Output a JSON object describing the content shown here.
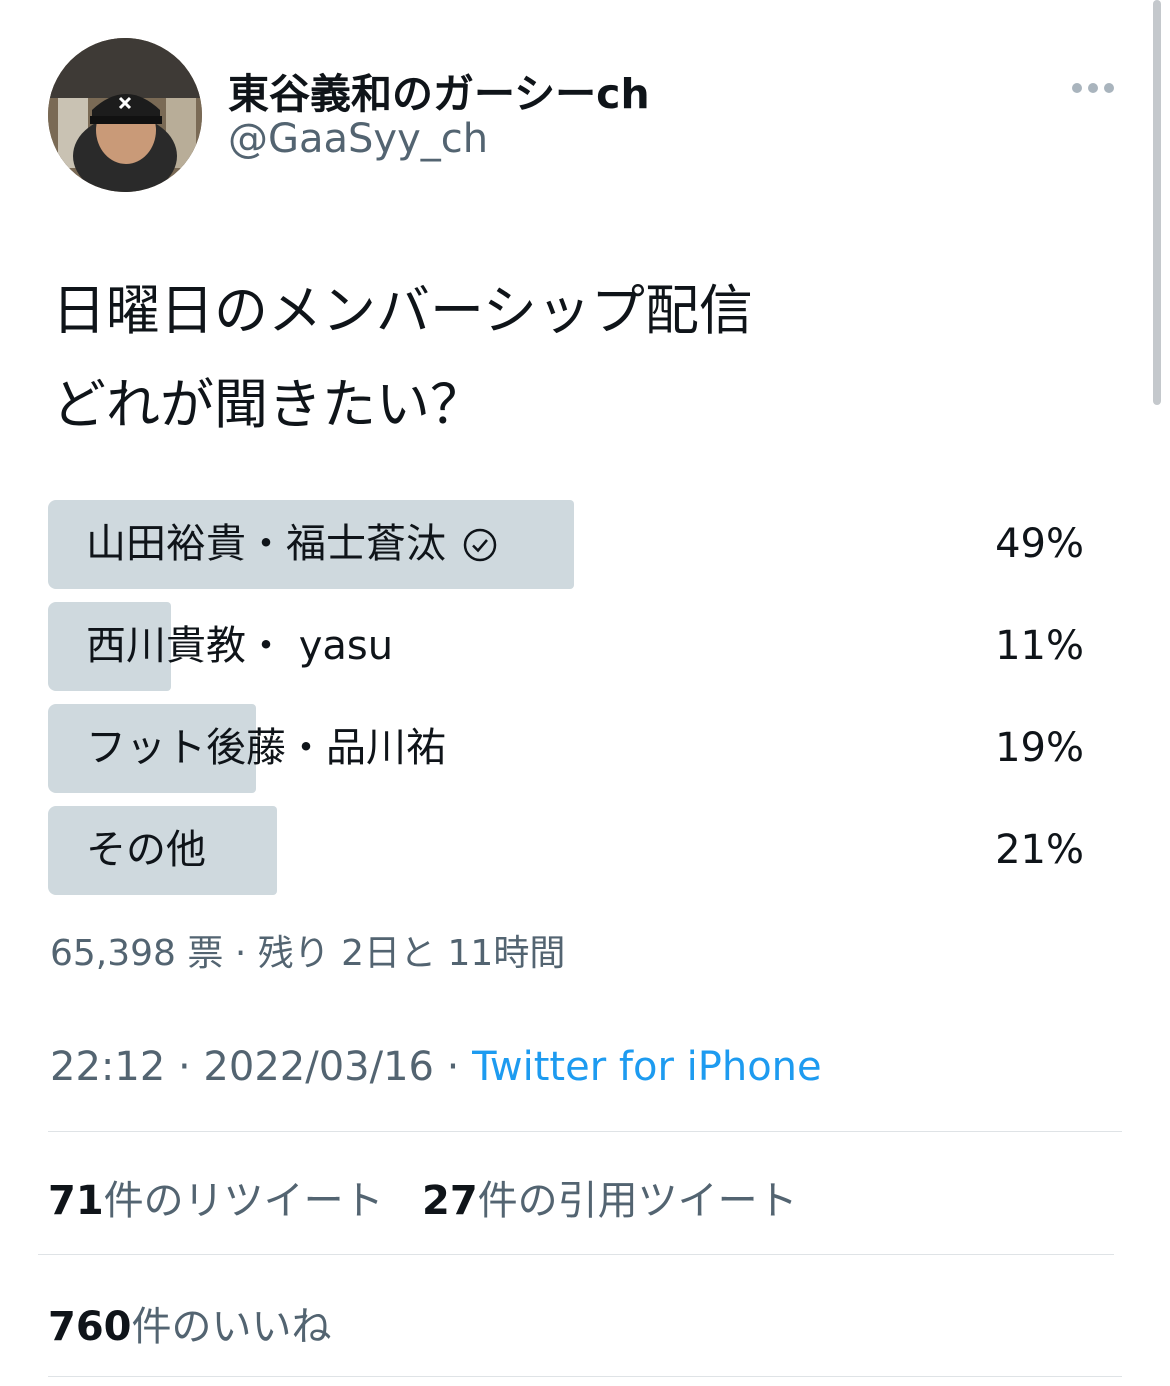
{
  "author": {
    "name": "東谷義和のガーシーch",
    "handle": "@GaaSyy_ch"
  },
  "tweet": {
    "line1": "日曜日のメンバーシップ配信",
    "line2": "どれが聞きたい？"
  },
  "poll": {
    "options": [
      {
        "label": "山田裕貴・福士蒼汰",
        "percent": "49%",
        "fraction": 0.49,
        "selected": true
      },
      {
        "label": "西川貴教・ yasu",
        "percent": "11%",
        "fraction": 0.11,
        "selected": false
      },
      {
        "label": "フット後藤・品川祐",
        "percent": "19%",
        "fraction": 0.19,
        "selected": false
      },
      {
        "label": "その他",
        "percent": "21%",
        "fraction": 0.21,
        "selected": false
      }
    ],
    "summary": "65,398 票 · 残り 2日と 11時間"
  },
  "meta": {
    "time": "22:12 · 2022/03/16 · ",
    "source": "Twitter for iPhone"
  },
  "stats": {
    "retweets_count": "71",
    "retweets_label": "件のリツイート",
    "quotes_count": "27",
    "quotes_label": "件の引用ツイート",
    "likes_count": "760",
    "likes_label": "件のいいね"
  },
  "icons": {
    "more": "more-dots-icon",
    "check": "check-circle-icon"
  },
  "colors": {
    "poll_fill": "#cfd9de",
    "link": "#1d9bf0",
    "secondary_text": "#536471"
  }
}
